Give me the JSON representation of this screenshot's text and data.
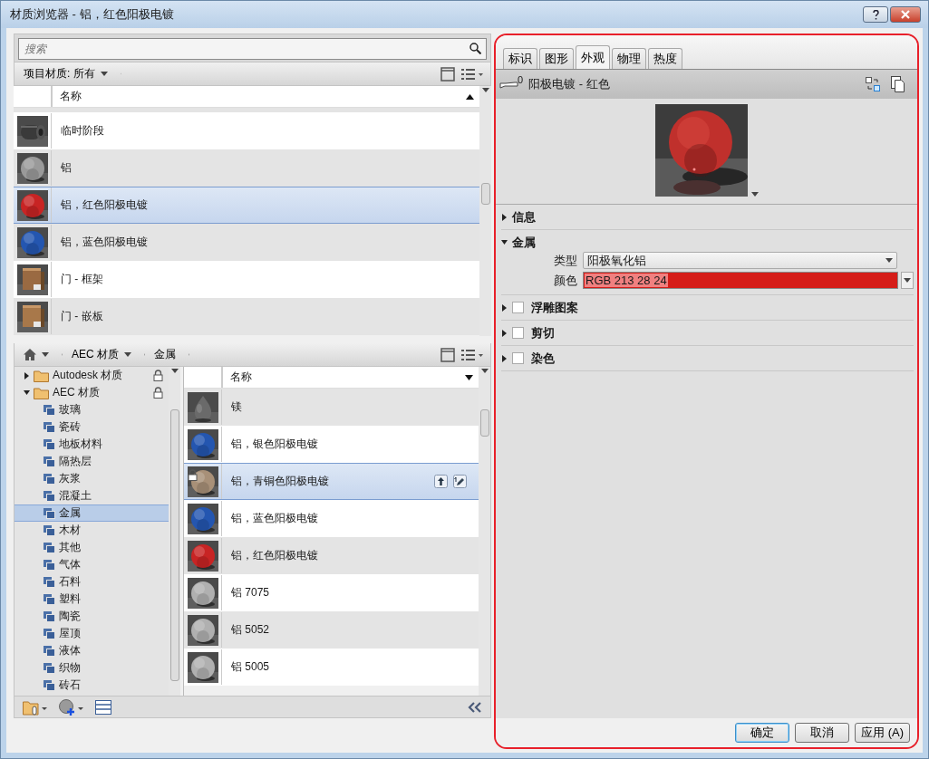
{
  "window": {
    "title": "材质浏览器 - 铝，红色阳极电镀"
  },
  "project_panel": {
    "search": {
      "placeholder": "搜索"
    },
    "filter": "项目材质: 所有",
    "column": "名称",
    "materials": [
      {
        "name": "临时阶段",
        "kind": "cylinder",
        "color": "#3a3a3a",
        "selected": false
      },
      {
        "name": "铝",
        "kind": "sphere",
        "color": "#9a9a9a",
        "selected": false
      },
      {
        "name": "铝，红色阳极电镀",
        "kind": "sphere",
        "color": "#c82424",
        "selected": true
      },
      {
        "name": "铝，蓝色阳极电镀",
        "kind": "sphere",
        "color": "#2456b0",
        "selected": false
      },
      {
        "name": "门 - 框架",
        "kind": "box",
        "color": "#9a6a42",
        "selected": false
      },
      {
        "name": "门 - 嵌板",
        "kind": "box",
        "color": "#a8784a",
        "selected": false
      }
    ]
  },
  "library_panel": {
    "breadcrumb": [
      "AEC 材质",
      "金属"
    ],
    "column": "名称",
    "tree": [
      {
        "label": "Autodesk 材质",
        "expanded": false,
        "locked": true,
        "selected": false
      },
      {
        "label": "AEC 材质",
        "expanded": true,
        "locked": true,
        "selected": false,
        "children": [
          {
            "label": "玻璃",
            "selected": false
          },
          {
            "label": "瓷砖",
            "selected": false
          },
          {
            "label": "地板材料",
            "selected": false
          },
          {
            "label": "隔热层",
            "selected": false
          },
          {
            "label": "灰浆",
            "selected": false
          },
          {
            "label": "混凝土",
            "selected": false
          },
          {
            "label": "金属",
            "selected": true
          },
          {
            "label": "木材",
            "selected": false
          },
          {
            "label": "其他",
            "selected": false
          },
          {
            "label": "气体",
            "selected": false
          },
          {
            "label": "石料",
            "selected": false
          },
          {
            "label": "塑料",
            "selected": false
          },
          {
            "label": "陶瓷",
            "selected": false
          },
          {
            "label": "屋顶",
            "selected": false
          },
          {
            "label": "液体",
            "selected": false
          },
          {
            "label": "织物",
            "selected": false
          },
          {
            "label": "砖石",
            "selected": false
          }
        ]
      }
    ],
    "materials": [
      {
        "name": "镁",
        "kind": "drop",
        "color": "#6a6a6a",
        "selected": false,
        "locked": false
      },
      {
        "name": "铝，银色阳极电镀",
        "kind": "sphere",
        "color": "#2456b0",
        "selected": false,
        "locked": false
      },
      {
        "name": "铝，青铜色阳极电镀",
        "kind": "sphere",
        "color": "#a89078",
        "selected": true,
        "locked": true
      },
      {
        "name": "铝，蓝色阳极电镀",
        "kind": "sphere",
        "color": "#2456b0",
        "selected": false,
        "locked": false
      },
      {
        "name": "铝，红色阳极电镀",
        "kind": "sphere",
        "color": "#c82424",
        "selected": false,
        "locked": false
      },
      {
        "name": "铝 7075",
        "kind": "sphere",
        "color": "#b0b0b0",
        "selected": false,
        "locked": false
      },
      {
        "name": "铝 5052",
        "kind": "sphere",
        "color": "#b0b0b0",
        "selected": false,
        "locked": false
      },
      {
        "name": "铝 5005",
        "kind": "sphere",
        "color": "#b0b0b0",
        "selected": false,
        "locked": false
      }
    ]
  },
  "editor": {
    "tabs": [
      {
        "label": "标识",
        "selected": false
      },
      {
        "label": "图形",
        "selected": false
      },
      {
        "label": "外观",
        "selected": true
      },
      {
        "label": "物理",
        "selected": false
      },
      {
        "label": "热度",
        "selected": false
      }
    ],
    "asset": {
      "count": "0",
      "name": "阳极电镀 - 红色"
    },
    "sections": [
      {
        "title": "信息",
        "expanded": false,
        "kind": "plain"
      },
      {
        "title": "金属",
        "expanded": true,
        "kind": "plain",
        "properties": [
          {
            "label": "类型",
            "kind": "select",
            "value": "阳极氧化铝"
          },
          {
            "label": "颜色",
            "kind": "color",
            "value": "RGB 213 28 24",
            "color": "#d51c18"
          }
        ]
      },
      {
        "title": "浮雕图案",
        "expanded": false,
        "kind": "toggle",
        "checked": false
      },
      {
        "title": "剪切",
        "expanded": false,
        "kind": "toggle",
        "checked": false
      },
      {
        "title": "染色",
        "expanded": false,
        "kind": "toggle",
        "checked": false
      }
    ]
  },
  "buttons": [
    {
      "label": "确定",
      "default": true
    },
    {
      "label": "取消",
      "default": false
    },
    {
      "label": "应用 (A)",
      "default": false
    }
  ]
}
